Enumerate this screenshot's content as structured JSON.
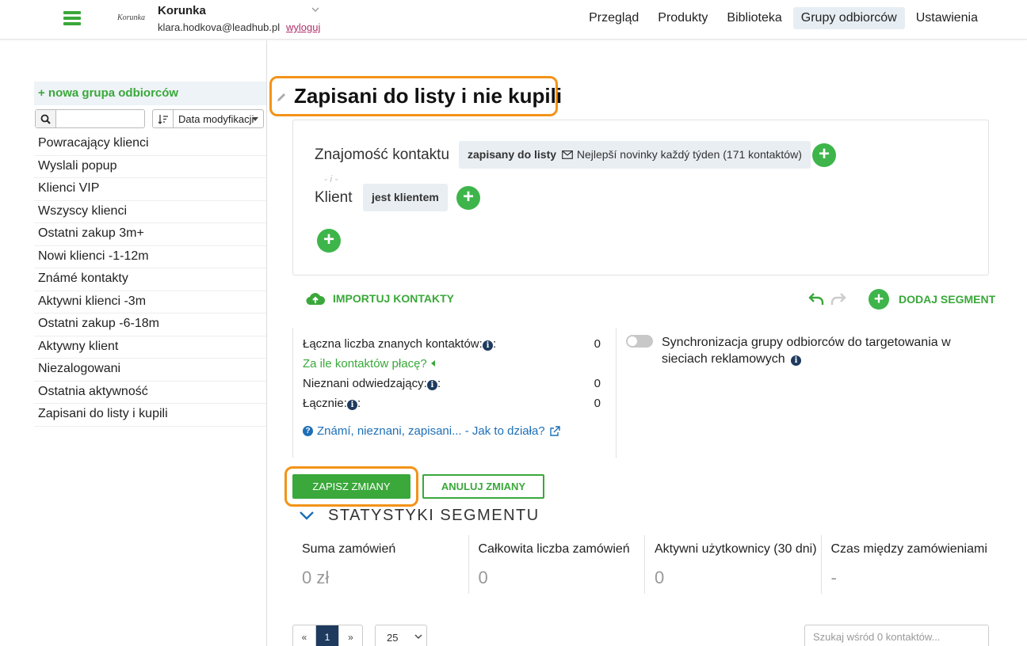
{
  "header": {
    "logo_text": "Korunka",
    "account_name": "Korunka",
    "email": "klara.hodkova@leadhub.pl",
    "logout": "wyloguj",
    "nav": [
      {
        "label": "Przegląd"
      },
      {
        "label": "Produkty"
      },
      {
        "label": "Biblioteka"
      },
      {
        "label": "Grupy odbiorców",
        "active": true
      },
      {
        "label": "Ustawienia"
      }
    ]
  },
  "sidebar": {
    "new_group": "+ nowa grupa odbiorców",
    "search_placeholder": "",
    "sort_label": "Data modyfikacji",
    "groups": [
      "Powracający klienci",
      "Wyslali popup",
      "Klienci VIP",
      "Wszyscy klienci",
      "Ostatni zakup 3m+",
      "Nowi klienci -1-12m",
      "Známé kontakty",
      "Aktywni klienci -3m",
      "Ostatni zakup -6-18m",
      "Aktywny klient",
      "Niezalogowani",
      "Ostatnia aktywność",
      "Zapisani do listy i kupili"
    ]
  },
  "main": {
    "title": "Zapisani do listy i nie kupili",
    "conditions": {
      "cond1_label": "Znajomość kontaktu",
      "cond1_chip_bold": "zapisany do listy",
      "cond1_chip_rest": "Nejlepší novinky každý týden (171 kontaktów)",
      "separator": "- i -",
      "cond2_label": "Klient",
      "cond2_chip": "jest klientem",
      "plus": "+"
    },
    "import_label": "IMPORTUJ KONTAKTY",
    "add_segment_label": "DODAJ SEGMENT",
    "stats": {
      "known_label": "Łączna liczba znanych kontaktów:",
      "known_value": "0",
      "price_link": "Za ile kontaktów płacę?",
      "unknown_label": "Nieznani odwiedzający:",
      "unknown_value": "0",
      "total_label": "Łącznie:",
      "total_value": "0",
      "help_link": "Známí, nieznani, zapisani... - Jak to działa?"
    },
    "sync_text": "Synchronizacja grupy odbiorców do targetowania w sieciach reklamowych",
    "save_button": "ZAPISZ ZMIANY",
    "cancel_button": "ANULUJ ZMIANY",
    "segment_stats_title": "STATYSTYKI SEGMENTU",
    "metrics": [
      {
        "label": "Suma zamówień",
        "value": "0 zł"
      },
      {
        "label": "Całkowita liczba zamówień",
        "value": "0"
      },
      {
        "label": "Aktywni użytkownicy (30 dni)",
        "value": "0"
      },
      {
        "label": "Czas między zamówieniami",
        "value": "-"
      }
    ],
    "pagination": {
      "prev": "«",
      "current": "1",
      "next": "»"
    },
    "per_page": "25",
    "contact_search_placeholder": "Szukaj wśród 0 kontaktów..."
  },
  "colors": {
    "accent_green": "#3aa83a",
    "highlight_orange": "#f39318",
    "nav_active_bg": "#e7eef3",
    "pager_active": "#1e3a5f"
  },
  "icons": {
    "menu": "hamburger-icon",
    "search": "search-icon",
    "sort": "sort-icon",
    "edit": "pencil-icon",
    "mail": "envelope-icon",
    "upload": "cloud-upload-icon",
    "undo": "undo-icon",
    "redo": "redo-icon",
    "info": "info-icon",
    "help": "question-icon",
    "external": "external-link-icon"
  }
}
